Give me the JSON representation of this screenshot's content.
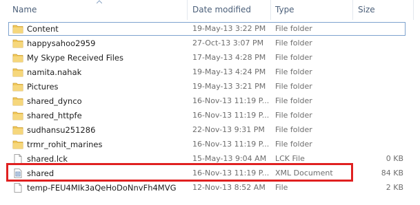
{
  "columns": {
    "name": "Name",
    "date_modified": "Date modified",
    "type": "Type",
    "size": "Size"
  },
  "files": [
    {
      "name": "Content",
      "date": "19-May-13 3:22 PM",
      "type": "File folder",
      "size": "",
      "icon": "folder-icon"
    },
    {
      "name": "happysahoo2959",
      "date": "27-Oct-13 3:07 PM",
      "type": "File folder",
      "size": "",
      "icon": "folder-icon"
    },
    {
      "name": "My Skype Received Files",
      "date": "17-May-13 4:28 PM",
      "type": "File folder",
      "size": "",
      "icon": "folder-icon"
    },
    {
      "name": "namita.nahak",
      "date": "19-May-13 4:24 PM",
      "type": "File folder",
      "size": "",
      "icon": "folder-icon"
    },
    {
      "name": "Pictures",
      "date": "19-May-13 3:21 PM",
      "type": "File folder",
      "size": "",
      "icon": "folder-icon"
    },
    {
      "name": "shared_dynco",
      "date": "16-Nov-13 11:19 P...",
      "type": "File folder",
      "size": "",
      "icon": "folder-icon"
    },
    {
      "name": "shared_httpfe",
      "date": "16-Nov-13 11:19 P...",
      "type": "File folder",
      "size": "",
      "icon": "folder-icon"
    },
    {
      "name": "sudhansu251286",
      "date": "22-Nov-13 9:31 PM",
      "type": "File folder",
      "size": "",
      "icon": "folder-icon"
    },
    {
      "name": "trmr_rohit_marines",
      "date": "16-Nov-13 11:19 P...",
      "type": "File folder",
      "size": "",
      "icon": "folder-icon"
    },
    {
      "name": "shared.lck",
      "date": "15-May-13 9:04 AM",
      "type": "LCK File",
      "size": "0 KB",
      "icon": "file-icon"
    },
    {
      "name": "shared",
      "date": "16-Nov-13 11:19 P...",
      "type": "XML Document",
      "size": "84 KB",
      "icon": "xml-file-icon"
    },
    {
      "name": "temp-FEU4MIk3aQeHoDoNnvFh4MVG",
      "date": "12-Nov-13 8:52 AM",
      "type": "File",
      "size": "2 KB",
      "icon": "file-icon"
    }
  ],
  "colors": {
    "folder": "#f1c85a",
    "highlight_border": "#e02020",
    "focus_border": "#7da2ce",
    "header_text": "#4c607a"
  }
}
